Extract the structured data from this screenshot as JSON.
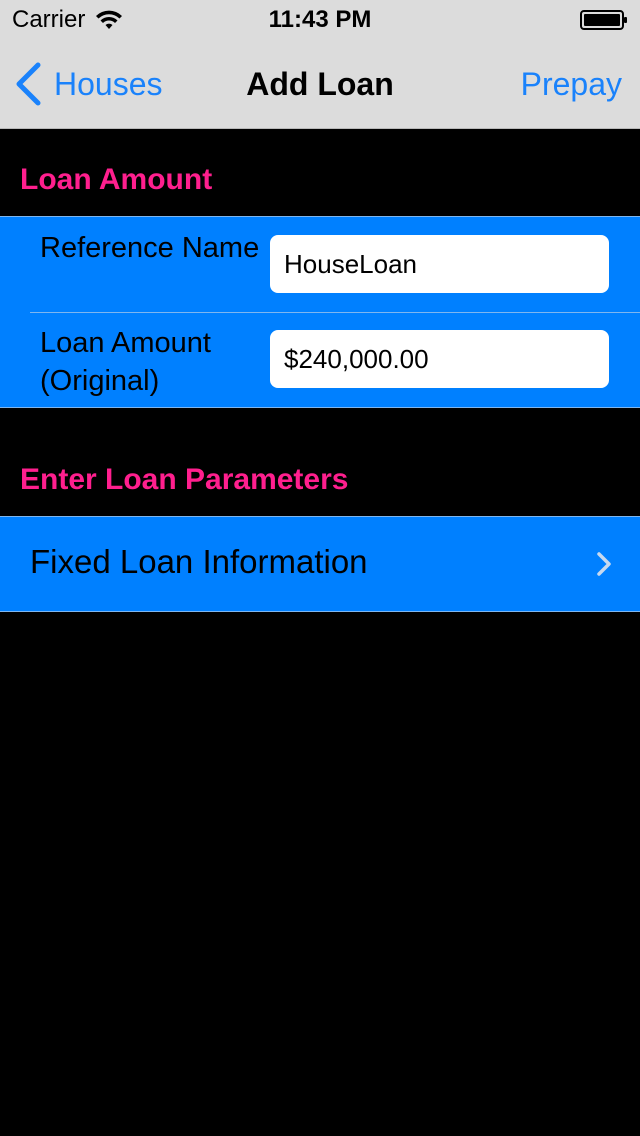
{
  "status_bar": {
    "carrier": "Carrier",
    "time": "11:43 PM"
  },
  "nav": {
    "back_label": "Houses",
    "title": "Add Loan",
    "right_label": "Prepay"
  },
  "sections": {
    "loan_amount": {
      "header": "Loan Amount",
      "rows": [
        {
          "label": "Reference Name",
          "value": "HouseLoan"
        },
        {
          "label": "Loan Amount (Original)",
          "value": "$240,000.00"
        }
      ]
    },
    "loan_parameters": {
      "header": "Enter Loan Parameters",
      "link_label": "Fixed Loan Information"
    }
  },
  "colors": {
    "accent": "#1a82fb",
    "section_header": "#ff1f8e",
    "cell_background": "#0080ff",
    "background": "#000000",
    "nav_background": "#dcdcdc"
  },
  "icons": {
    "wifi": "wifi-icon",
    "battery": "battery-icon",
    "back": "chevron-left-icon",
    "disclosure": "chevron-right-icon"
  }
}
